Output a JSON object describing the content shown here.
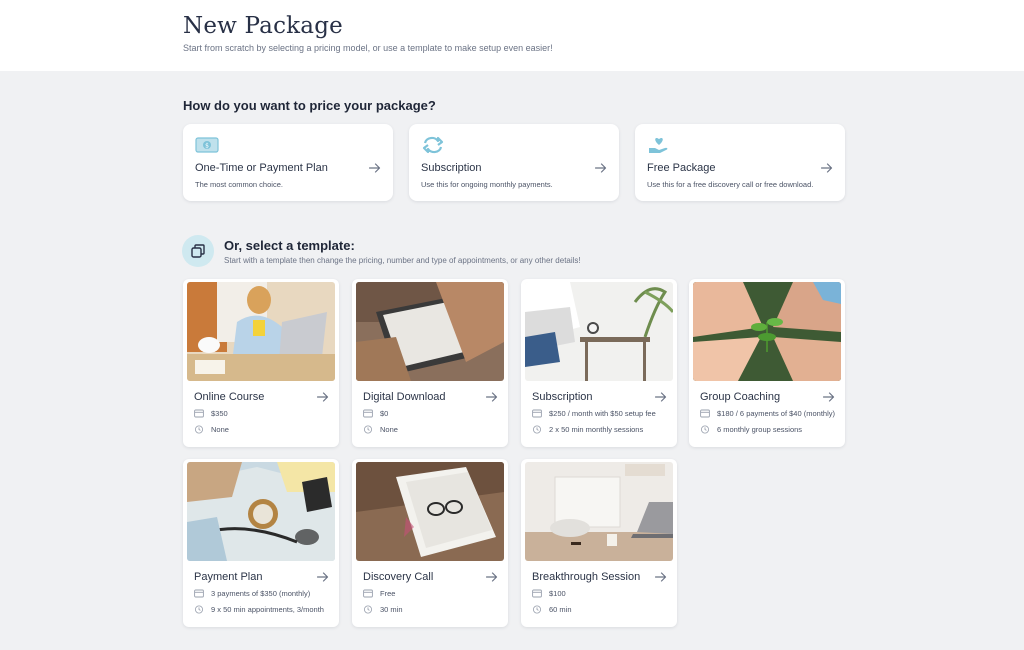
{
  "header": {
    "title": "New Package",
    "subtitle": "Start from scratch by selecting a pricing model, or use a template to make setup even easier!"
  },
  "pricing": {
    "heading": "How do you want to price your package?",
    "options": [
      {
        "title": "One-Time or Payment Plan",
        "desc": "The most common choice.",
        "icon": "money-icon"
      },
      {
        "title": "Subscription",
        "desc": "Use this for ongoing monthly payments.",
        "icon": "recurring-icon"
      },
      {
        "title": "Free Package",
        "desc": "Use this for a free discovery call or free download.",
        "icon": "heart-hand-icon"
      }
    ]
  },
  "templates": {
    "heading": "Or, select a template:",
    "subtitle": "Start with a template then change the pricing, number and type of appointments, or any other details!",
    "items": [
      {
        "name": "Online Course",
        "price": "$350",
        "sessions": "None"
      },
      {
        "name": "Digital Download",
        "price": "$0",
        "sessions": "None"
      },
      {
        "name": "Subscription",
        "price": "$250 / month with $50 setup fee",
        "sessions": "2 x 50 min monthly sessions"
      },
      {
        "name": "Group Coaching",
        "price": "$180 / 6 payments of $40 (monthly)",
        "sessions": "6 monthly group sessions"
      },
      {
        "name": "Payment Plan",
        "price": "3 payments of $350 (monthly)",
        "sessions": "9 x 50 min appointments, 3/month"
      },
      {
        "name": "Discovery Call",
        "price": "Free",
        "sessions": "30 min"
      },
      {
        "name": "Breakthrough Session",
        "price": "$100",
        "sessions": "60 min"
      }
    ]
  },
  "colors": {
    "accent": "#7ec3d9",
    "background": "#f0f1f3",
    "text": "#2b3447"
  }
}
